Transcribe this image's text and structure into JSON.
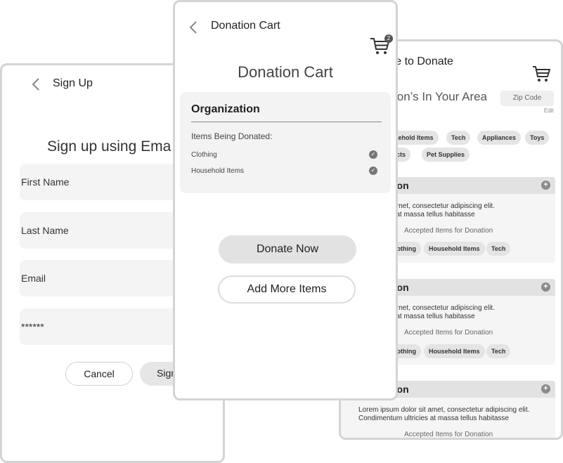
{
  "signup": {
    "header_title": "Sign Up",
    "heading": "Sign up using Ema",
    "fields": [
      "First Name",
      "Last Name",
      "Email",
      "******"
    ],
    "cancel_label": "Cancel",
    "signup_label": "Sign"
  },
  "cart": {
    "header_title": "Donation Cart",
    "cart_badge": "2",
    "heading": "Donation Cart",
    "organization_label": "Organization",
    "items_heading": "Items Being Donated:",
    "items": [
      "Clothing",
      "Household Items"
    ],
    "donate_now_label": "Donate Now",
    "add_more_label": "Add More Items"
  },
  "where": {
    "title": "ere to Donate",
    "area_heading": "ion’s In Your Area",
    "zip_placeholder": "Zip Code",
    "edit_label": "Edit",
    "filter_chips_row1": [
      "usehold Items",
      "Tech",
      "Appliances",
      "Toys"
    ],
    "filter_chips_row2": [
      "lucts",
      "Pet Supplies"
    ],
    "organizations": [
      {
        "name": "tion",
        "lorem_line1": "m dolor sit amet, consectetur adipiscing elit.",
        "lorem_line2": "um ultricies at massa tellus habitasse",
        "accepted_label": "Accepted Items for Donation",
        "tags": [
          "lothing",
          "Household Items",
          "Tech"
        ]
      },
      {
        "name": "tion",
        "lorem_line1": "m dolor sit amet, consectetur adipiscing elit.",
        "lorem_line2": "um ultricies at massa tellus habitasse",
        "accepted_label": "Accepted Items for Donation",
        "tags": [
          "lothing",
          "Household Items",
          "Tech"
        ]
      },
      {
        "name": "tion",
        "lorem_line1": "Lorem ipsum dolor sit amet, consectetur adipiscing elit.",
        "lorem_line2": "Condimentum ultricies at massa tellus habitasse",
        "accepted_label": "Accepted Items for Donation"
      }
    ]
  }
}
